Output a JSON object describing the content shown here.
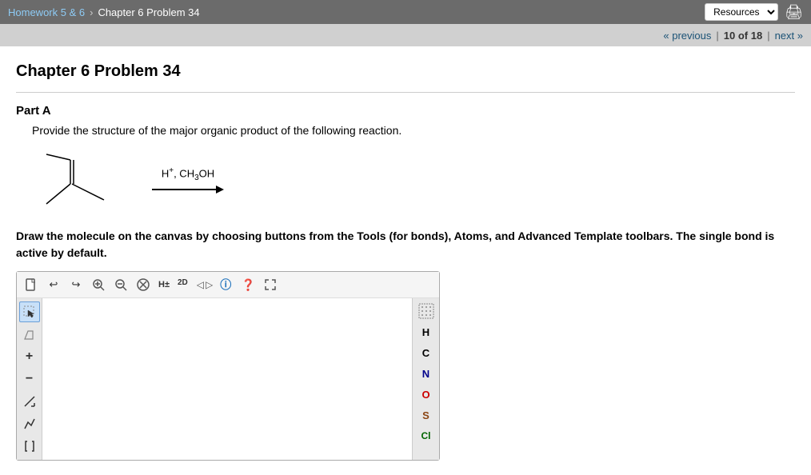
{
  "topNav": {
    "breadcrumbLink": "Homework 5 & 6",
    "breadcrumbCurrent": "Chapter 6 Problem 34",
    "resourcesLabel": "Resources",
    "printTitle": "Print"
  },
  "pagination": {
    "previousLabel": "« previous",
    "countLabel": "10 of 18",
    "nextLabel": "next »"
  },
  "chapterTitle": "Chapter 6 Problem 34",
  "partA": {
    "label": "Part A",
    "questionText": "Provide the structure of the major organic product of the following reaction.",
    "reactionCondition": "H⁺, CH₃OH",
    "instructions": "Draw the molecule on the canvas by choosing buttons from the Tools (for bonds), Atoms, and Advanced Template toolbars. The single bond is active by default."
  },
  "toolbar": {
    "newBtn": "📄",
    "undoBtn": "↩",
    "redoBtn": "↪",
    "zoomInBtn": "⊕",
    "zoomOutBtn": "⊖",
    "clearBtn": "⊗",
    "hBtn": "H±",
    "twoDBtn": "2D",
    "infoBtn": "ℹ",
    "helpBtn": "❓",
    "expandBtn": "⤢"
  },
  "leftTools": [
    {
      "id": "select",
      "label": "⬚↖",
      "active": true
    },
    {
      "id": "erase",
      "label": "◇"
    },
    {
      "id": "plus",
      "label": "+"
    },
    {
      "id": "minus",
      "label": "−"
    },
    {
      "id": "bond",
      "label": "/"
    },
    {
      "id": "chain",
      "label": "⌐"
    },
    {
      "id": "bracket",
      "label": "["
    }
  ],
  "rightAtoms": [
    {
      "id": "dots",
      "label": "⠿",
      "color": "#555",
      "isDots": true
    },
    {
      "id": "H",
      "label": "H",
      "color": "#000"
    },
    {
      "id": "C",
      "label": "C",
      "color": "#000"
    },
    {
      "id": "N",
      "label": "N",
      "color": "#00008b"
    },
    {
      "id": "O",
      "label": "O",
      "color": "#cc0000"
    },
    {
      "id": "S",
      "label": "S",
      "color": "#8b4513"
    },
    {
      "id": "Cl",
      "label": "Cl",
      "color": "#006400"
    }
  ]
}
